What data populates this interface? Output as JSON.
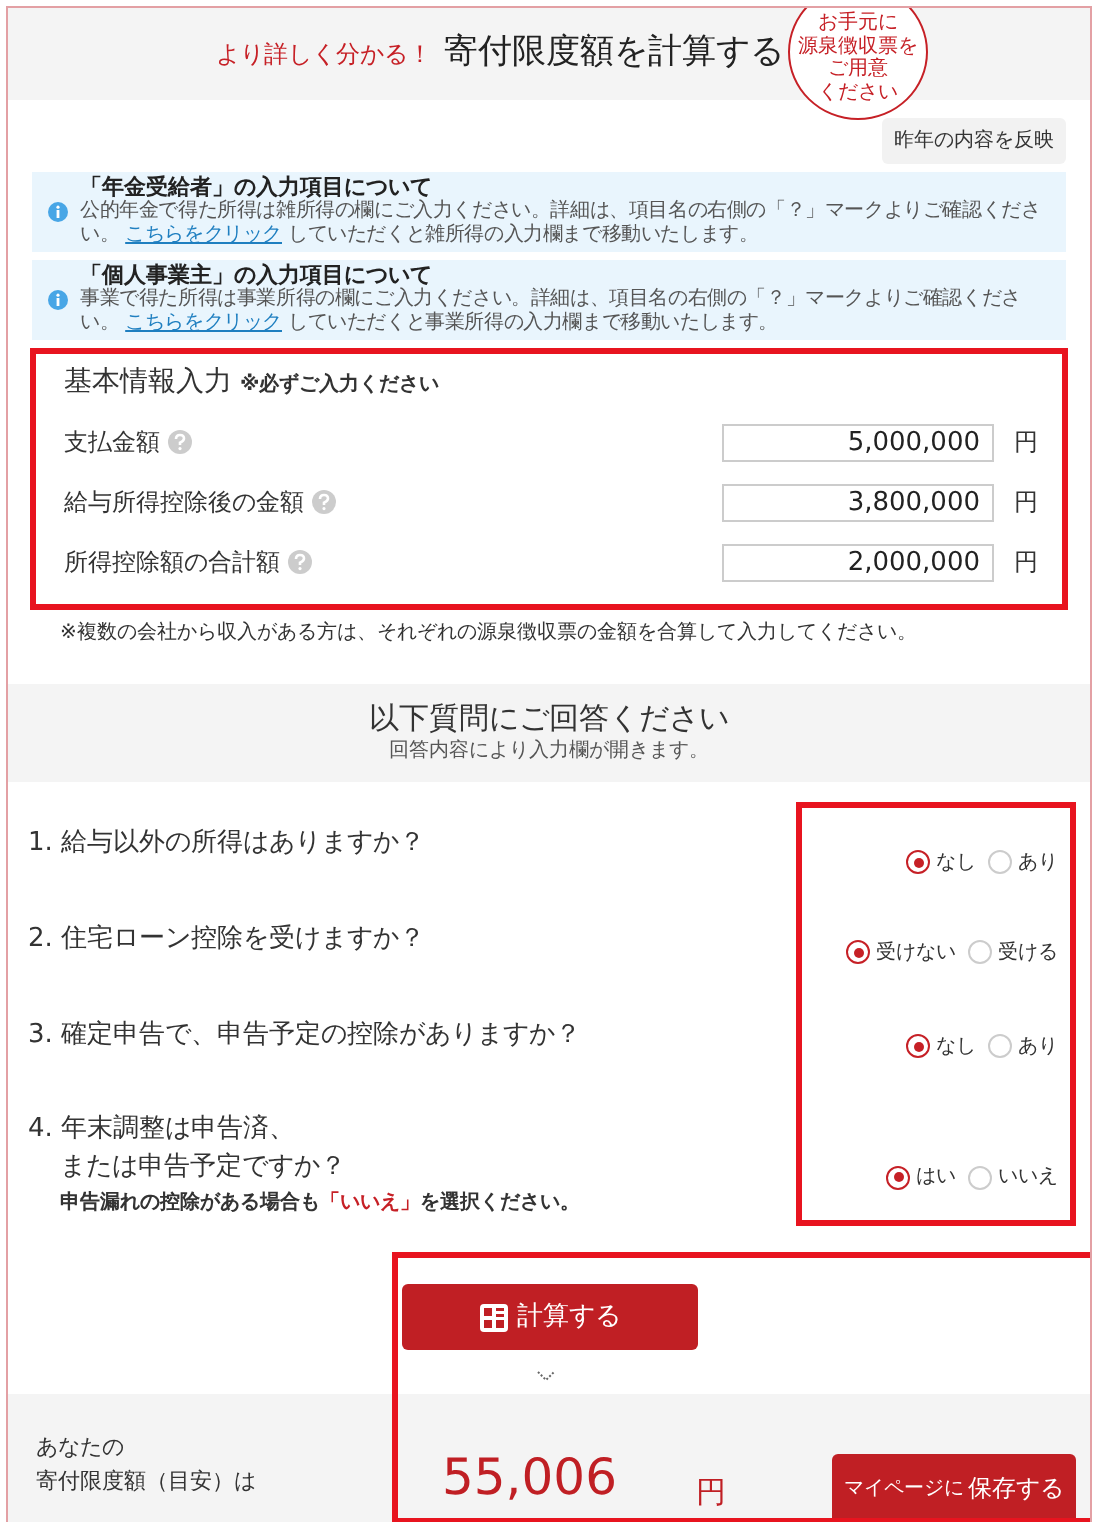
{
  "header": {
    "tagline": "より詳しく分かる！",
    "title": "寄付限度額を計算する",
    "bubble_lines": [
      "お手元に",
      "源泉徴収票を",
      "ご用意",
      "ください"
    ]
  },
  "copy_button": "昨年の内容を反映",
  "notices": [
    {
      "title": "「年金受給者」の入力項目について",
      "text_before": "公的年金で得た所得は雑所得の欄にご入力ください。詳細は、項目名の右側の「？」マークよりご確認ください。",
      "link": "こちらをクリック",
      "text_after": "していただくと雑所得の入力欄まで移動いたします。"
    },
    {
      "title": "「個人事業主」の入力項目について",
      "text_before": "事業で得た所得は事業所得の欄にご入力ください。詳細は、項目名の右側の「？」マークよりご確認ください。",
      "link": "こちらをクリック",
      "text_after": "していただくと事業所得の入力欄まで移動いたします。"
    }
  ],
  "basic": {
    "title": "基本情報入力",
    "required_note": "※必ずご入力ください",
    "fields": [
      {
        "label": "支払金額",
        "value": "5,000,000",
        "unit": "円"
      },
      {
        "label": "給与所得控除後の金額",
        "value": "3,800,000",
        "unit": "円"
      },
      {
        "label": "所得控除額の合計額",
        "value": "2,000,000",
        "unit": "円"
      }
    ],
    "footnote": "※複数の会社から収入がある方は、それぞれの源泉徴収票の金額を合算して入力してください。"
  },
  "questions": {
    "title": "以下質問にご回答ください",
    "subtitle": "回答内容により入力欄が開きます。",
    "items": [
      {
        "lines": [
          "1. 給与以外の所得はありますか？"
        ],
        "options": [
          {
            "label": "なし",
            "selected": true
          },
          {
            "label": "あり",
            "selected": false
          }
        ]
      },
      {
        "lines": [
          "2. 住宅ローン控除を受けますか？"
        ],
        "options": [
          {
            "label": "受けない",
            "selected": true
          },
          {
            "label": "受ける",
            "selected": false
          }
        ]
      },
      {
        "lines": [
          "3. 確定申告で、申告予定の控除がありますか？"
        ],
        "options": [
          {
            "label": "なし",
            "selected": true
          },
          {
            "label": "あり",
            "selected": false
          }
        ]
      },
      {
        "lines": [
          "4. 年末調整は申告済、",
          "または申告予定ですか？"
        ],
        "note": {
          "before": "申告漏れの控除がある場合も",
          "emphasis": "「いいえ」",
          "after": "を選択ください。"
        },
        "options": [
          {
            "label": "はい",
            "selected": true
          },
          {
            "label": "いいえ",
            "selected": false
          }
        ]
      }
    ]
  },
  "calc_button": "計算する",
  "result": {
    "label_lines": [
      "あなたの",
      "寄付限度額（目安）は"
    ],
    "amount": "55,006",
    "unit": "円",
    "save_prefix": "マイページに",
    "save_label": "保存する"
  }
}
